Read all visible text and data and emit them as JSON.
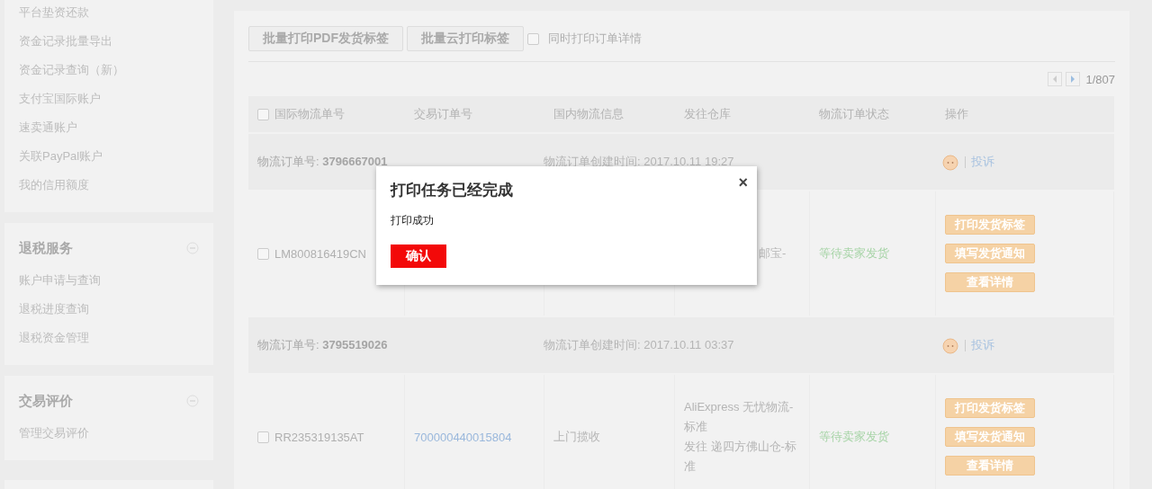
{
  "sidebar": {
    "sections": [
      {
        "items": [
          "平台垫资还款",
          "资金记录批量导出",
          "资金记录查询（新）",
          "支付宝国际账户",
          "速卖通账户",
          "关联PayPal账户",
          "我的信用额度"
        ]
      },
      {
        "title": "退税服务",
        "expanded": true,
        "items": [
          "账户申请与查询",
          "退税进度查询",
          "退税资金管理"
        ]
      },
      {
        "title": "交易评价",
        "expanded": true,
        "items": [
          "管理交易评价"
        ]
      }
    ]
  },
  "toolbar": {
    "buttons": [
      "批量打印PDF发货标签",
      "批量云打印标签"
    ],
    "checkbox": {
      "label": "同时打印订单详情",
      "checked": false
    }
  },
  "pager": {
    "page": "1/807"
  },
  "table": {
    "select_all": {
      "checked": false
    },
    "columns": [
      "国际物流单号",
      "交易订单号",
      "国内物流信息",
      "发往仓库",
      "物流订单状态",
      "操作"
    ],
    "groups": [
      {
        "order": "物流订单号: **3796667001**",
        "created": "物流订单创建时间: 2017.10.11 19:27",
        "complaint": "投诉",
        "items": [
          {
            "tracking": "LM800816419CN",
            "checked": false,
            "warehouse_lines": [
              "邮宝-"
            ],
            "status": "等待卖家发货",
            "actions": [
              "打印发货标签",
              "填写发货通知",
              "查看详情"
            ]
          }
        ]
      },
      {
        "order": "物流订单号: **3795519026**",
        "created": "物流订单创建时间: 2017.10.11 03:37",
        "complaint": "投诉",
        "items": [
          {
            "tracking": "RR235319135AT",
            "checked": false,
            "trade_order": "700000440015804",
            "domestic": "上门揽收",
            "warehouse_lines": [
              "AliExpress 无忧物流-标准",
              "发往 递四方佛山仓-标准"
            ],
            "status": "等待卖家发货",
            "actions": [
              "打印发货标签",
              "填写发货通知",
              "查看详情"
            ]
          }
        ]
      }
    ]
  },
  "dialog": {
    "title": "打印任务已经完成",
    "message": "打印成功",
    "confirm": "确认",
    "close": "×"
  }
}
